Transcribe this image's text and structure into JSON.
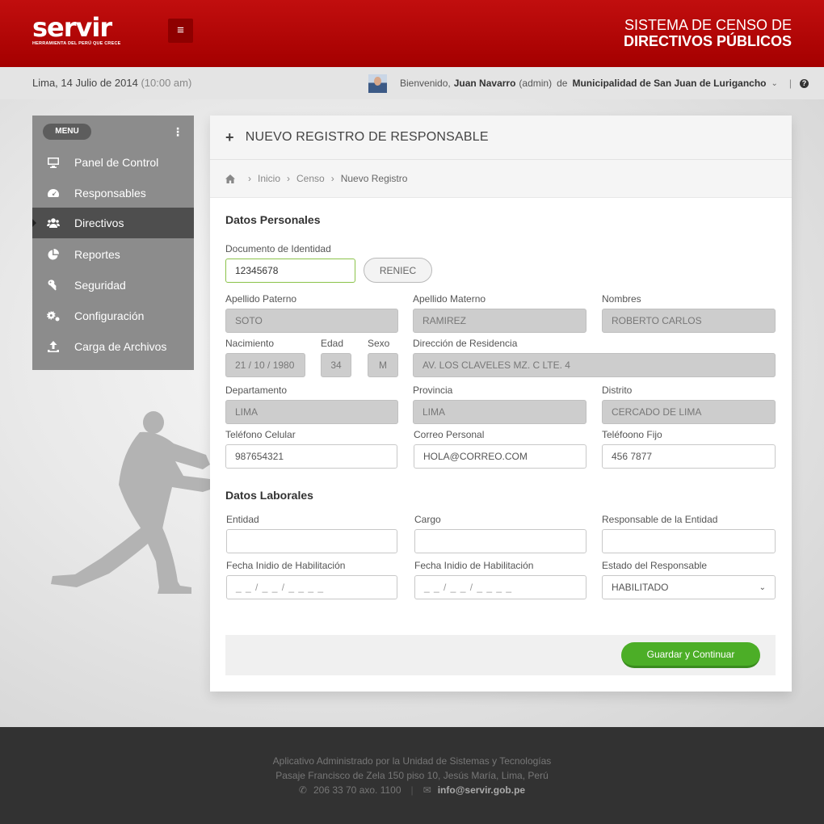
{
  "header": {
    "logo_text": "servir",
    "logo_tagline": "HERRAMIENTA DEL PERÚ QUE CRECE",
    "title_line1": "SISTEMA DE CENSO  DE",
    "title_line2": "DIRECTIVOS PÚBLICOS",
    "brand_color": "#b50000"
  },
  "infobar": {
    "date": "Lima, 14 Julio de 2014",
    "time": "(10:00 am)",
    "welcome": "Bienvenido,",
    "user_name": "Juan Navarro",
    "user_role": "(admin)",
    "de": "de",
    "municipality": "Municipalidad de San Juan de Lurigancho",
    "separator": "|"
  },
  "sidebar": {
    "menu_label": "MENU",
    "items": [
      {
        "label": "Panel de Control",
        "icon": "monitor-icon"
      },
      {
        "label": "Responsables",
        "icon": "dashboard-gauge-icon"
      },
      {
        "label": "Directivos",
        "icon": "users-icon",
        "active": true
      },
      {
        "label": "Reportes",
        "icon": "pie-chart-icon"
      },
      {
        "label": "Seguridad",
        "icon": "key-icon"
      },
      {
        "label": "Configuración",
        "icon": "gears-icon"
      },
      {
        "label": "Carga de Archivos",
        "icon": "upload-icon"
      }
    ]
  },
  "panel": {
    "title": "NUEVO REGISTRO DE RESPONSABLE",
    "breadcrumb": [
      "Inicio",
      "Censo",
      "Nuevo Registro"
    ],
    "personal": {
      "section_title": "Datos Personales",
      "doc_label": "Documento de Identidad",
      "doc_value": "12345678",
      "reniec_button": "RENIEC",
      "apellido_paterno_label": "Apellido Paterno",
      "apellido_paterno": "SOTO",
      "apellido_materno_label": "Apellido Materno",
      "apellido_materno": "RAMIREZ",
      "nombres_label": "Nombres",
      "nombres": "ROBERTO CARLOS",
      "nacimiento_label": "Nacimiento",
      "nacimiento": "21 / 10 / 1980",
      "edad_label": "Edad",
      "edad": "34",
      "sexo_label": "Sexo",
      "sexo": "M",
      "direccion_label": "Dirección de Residencia",
      "direccion": "AV. LOS CLAVELES MZ. C LTE. 4",
      "departamento_label": "Departamento",
      "departamento": "LIMA",
      "provincia_label": "Provincia",
      "provincia": "LIMA",
      "distrito_label": "Distrito",
      "distrito": "CERCADO DE LIMA",
      "celular_label": "Teléfono Celular",
      "celular": "987654321",
      "correo_label": "Correo Personal",
      "correo": "HOLA@CORREO.COM",
      "fijo_label": "Teléfoono Fijo",
      "fijo": "456 7877"
    },
    "laboral": {
      "section_title": "Datos Laborales",
      "entidad_label": "Entidad",
      "entidad": "",
      "cargo_label": "Cargo",
      "cargo": "",
      "responsable_label": "Responsable de la Entidad",
      "responsable": "",
      "fecha1_label": "Fecha Inidio de Habilitación",
      "fecha1_placeholder": "_ _ / _ _ / _ _ _ _",
      "fecha2_label": "Fecha Inidio de Habilitación",
      "fecha2_placeholder": "_ _ / _ _ / _ _ _ _",
      "estado_label": "Estado del Responsable",
      "estado": "HABILITADO"
    },
    "save_button": "Guardar y Continuar",
    "save_color": "#4cae27"
  },
  "footer": {
    "line1": "Aplicativo Administrado por la Unidad de Sistemas y Tecnologías",
    "line2": "Pasaje Francisco de Zela 150 piso 10, Jesús María, Lima, Perú",
    "phone": "206 33 70 axo. 1100",
    "separator": "|",
    "email": "info@servir.gob.pe"
  }
}
